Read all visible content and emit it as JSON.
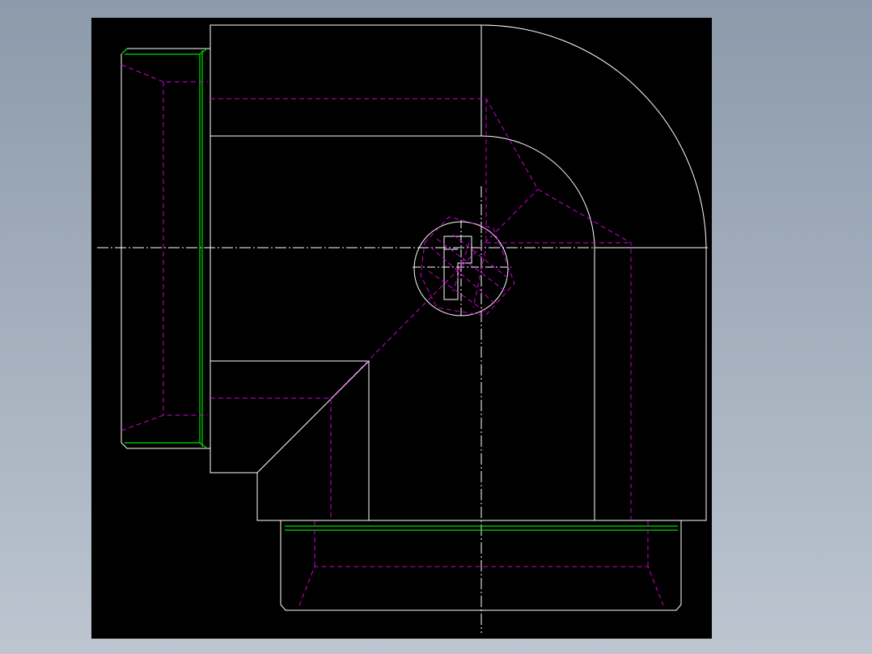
{
  "window": {
    "background_gradient": [
      "#8c9aab",
      "#bcc5d0"
    ]
  },
  "drawing": {
    "view": "front-view",
    "part": "90-degree-pipe-elbow-with-threaded-ends",
    "canvas_color": "#000000",
    "colors": {
      "outline": "#ffffff",
      "hidden_line": "#d000d0",
      "thread": "#00dd00",
      "centerline": "#ffffff"
    },
    "line_styles": {
      "hidden": "dashed",
      "centerline": "dash-dot"
    }
  }
}
